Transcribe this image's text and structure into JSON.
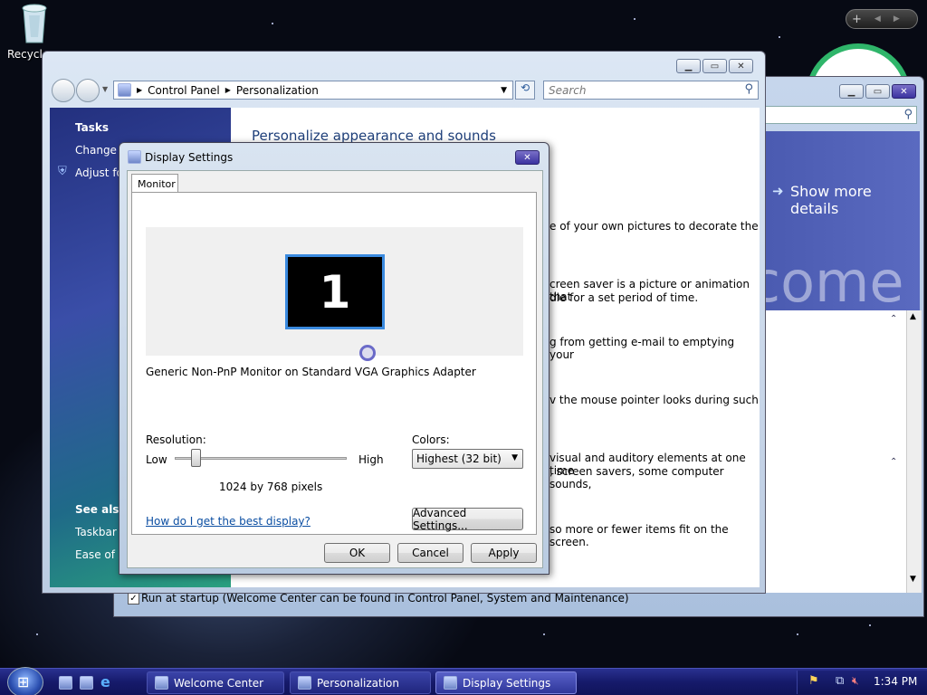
{
  "desktop": {
    "recycle_label": "Recycle"
  },
  "control_panel": {
    "breadcrumb": [
      "Control Panel",
      "Personalization"
    ],
    "search_placeholder": "Search",
    "tasks_title": "Tasks",
    "tasks": [
      "Change d",
      "Adjust fo"
    ],
    "see_also_title": "See also",
    "see_also": [
      "Taskbar a",
      "Ease of A"
    ],
    "heading": "Personalize appearance and sounds",
    "desc_lines": [
      "e of your own pictures to decorate the",
      "creen saver is a picture or animation that",
      "dle for a set period of time.",
      "g from getting e-mail to emptying your",
      "v the mouse pointer looks during such",
      "visual and auditory elements at one time",
      ", screen savers, some computer sounds,",
      "so more or fewer items fit on the screen."
    ]
  },
  "welcome": {
    "show_more": "Show more details",
    "banner_text": "come",
    "startup_label": "Run at startup (Welcome Center can be found in Control Panel, System and Maintenance)"
  },
  "display_settings": {
    "title": "Display Settings",
    "tab": "Monitor",
    "monitor_number": "1",
    "adapter": "Generic Non-PnP Monitor on Standard VGA Graphics Adapter",
    "resolution_label": "Resolution:",
    "low": "Low",
    "high": "High",
    "resolution_value": "1024 by 768 pixels",
    "resolution_level": 0.1,
    "colors_label": "Colors:",
    "colors_value": "Highest (32 bit)",
    "help_link": "How do I get the best display?",
    "advanced": "Advanced Settings...",
    "ok": "OK",
    "cancel": "Cancel",
    "apply": "Apply"
  },
  "taskbar": {
    "items": [
      "Welcome Center",
      "Personalization",
      "Display Settings"
    ],
    "clock": "1:34 PM"
  },
  "colors": {
    "accent": "#0b4ea2",
    "taskbar": "#161a6b"
  }
}
